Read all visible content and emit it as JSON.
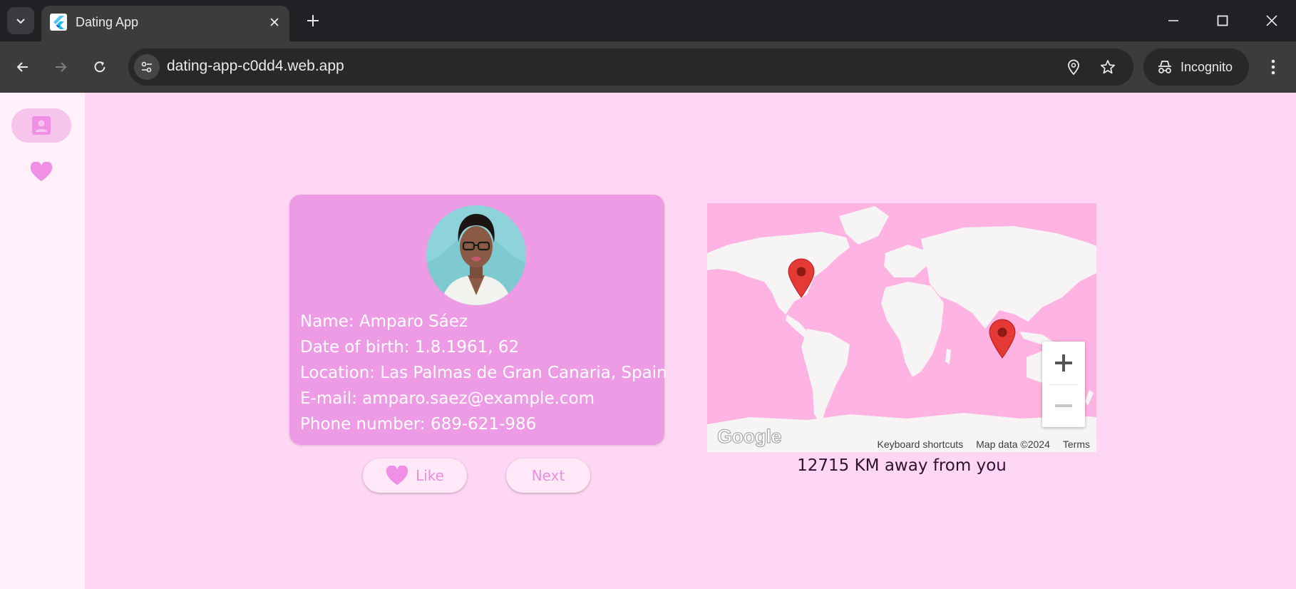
{
  "browser": {
    "tab_title": "Dating App",
    "url": "dating-app-c0dd4.web.app",
    "incognito_label": "Incognito"
  },
  "rail": {
    "items": [
      {
        "icon": "profile-card-icon",
        "active": true
      },
      {
        "icon": "heart-icon",
        "active": false
      }
    ]
  },
  "profile": {
    "name_line": "Name: Amparo Sáez",
    "dob_line": "Date of birth: 1.8.1961, 62",
    "location_line": "Location: Las Palmas de Gran Canaria, Spain",
    "email_line": "E-mail: amparo.saez@example.com",
    "phone_line": "Phone number: 689-621-986"
  },
  "actions": {
    "like_label": "Like",
    "next_label": "Next"
  },
  "map": {
    "logo": "Google",
    "keyboard_shortcuts": "Keyboard shortcuts",
    "map_data": "Map data ©2024",
    "terms": "Terms"
  },
  "distance_text": "12715 KM away from you",
  "colors": {
    "page_bg": "#ffd6f3",
    "rail_bg": "#fff0fa",
    "card_bg": "#ee9be6",
    "accent": "#ef8fe6",
    "map_water": "#ffb3e2",
    "map_land": "#f6f4f5",
    "marker": "#e53935"
  }
}
